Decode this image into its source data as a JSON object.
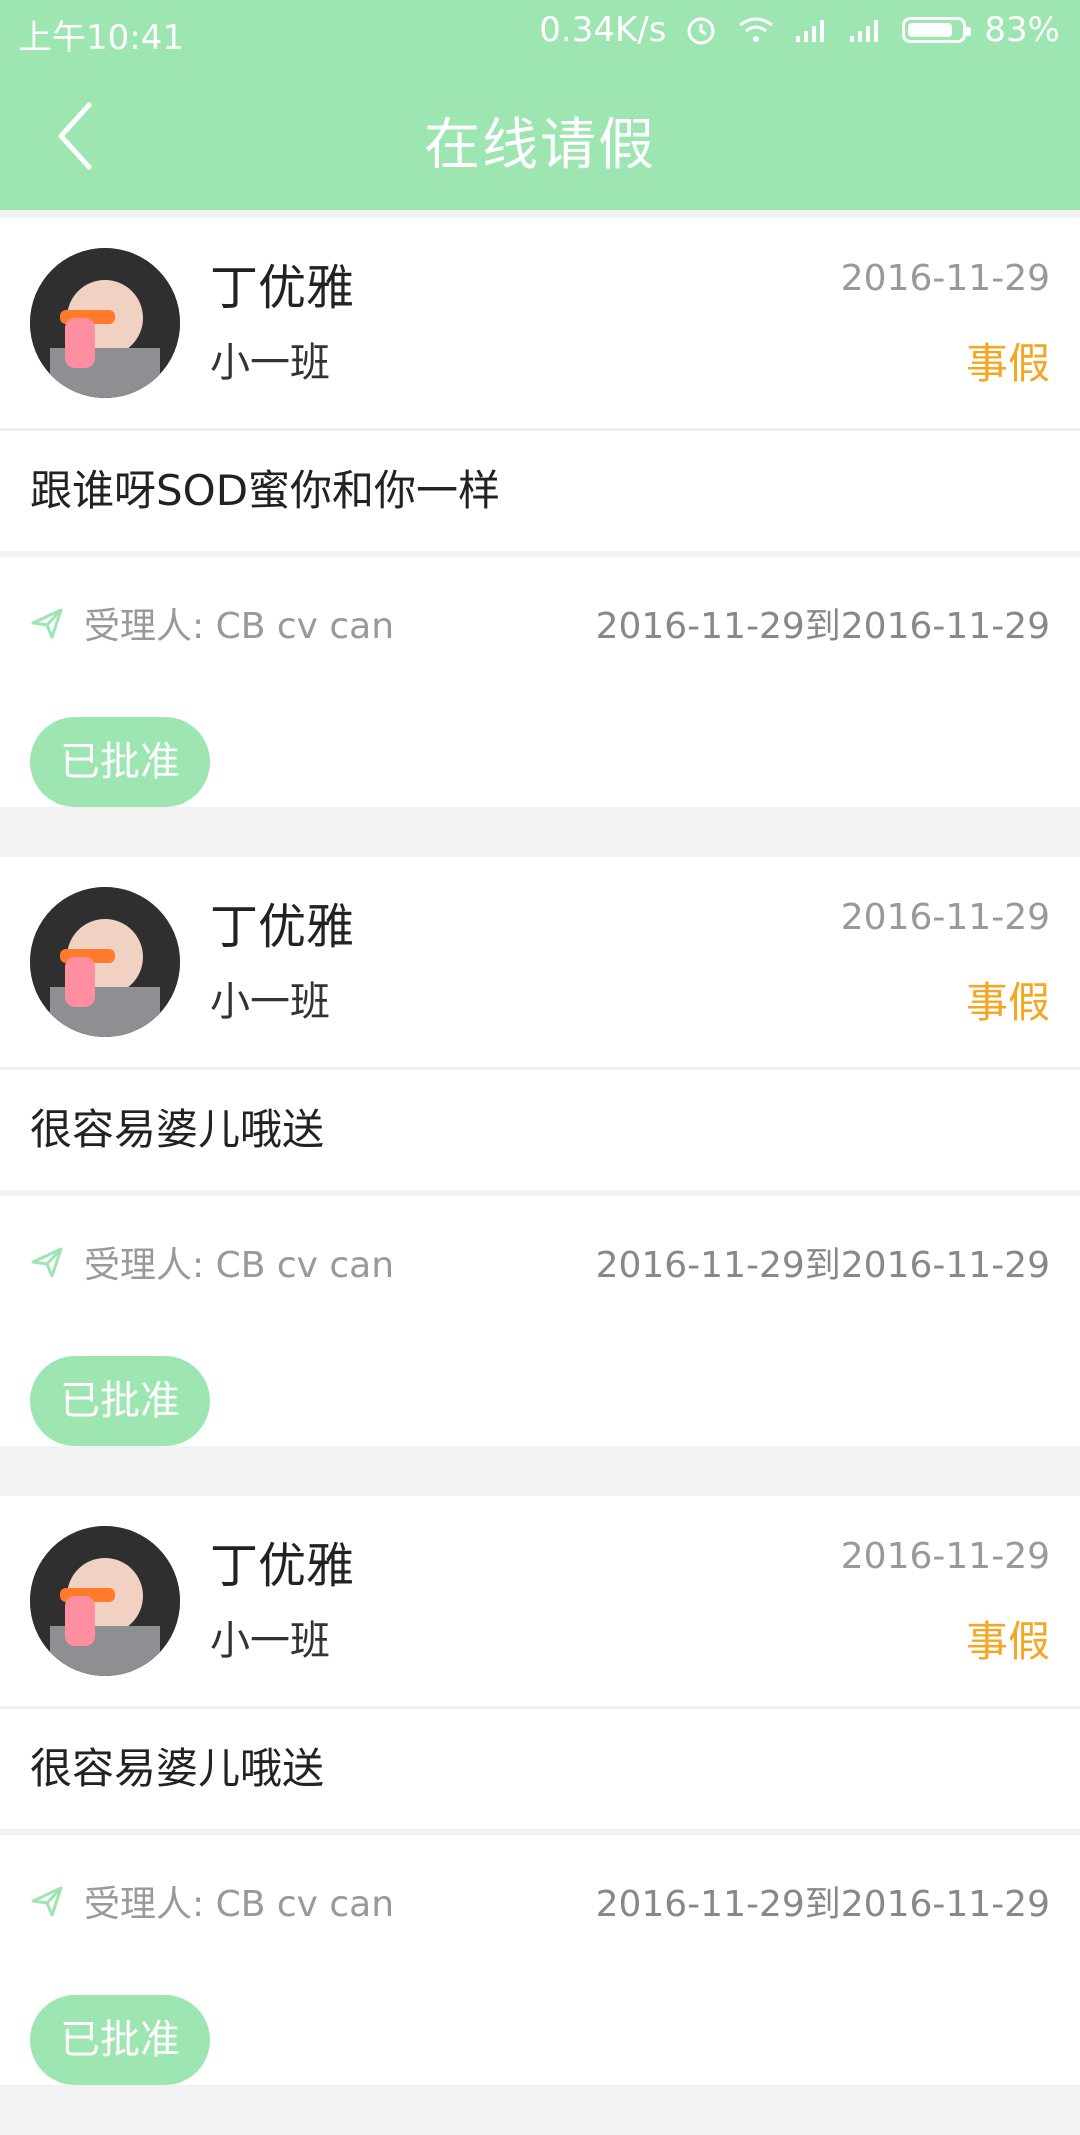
{
  "status_bar": {
    "time": "上午10:41",
    "network_speed": "0.34K/s",
    "battery_percent": "83%",
    "icons": [
      "alarm-icon",
      "wifi-icon",
      "signal-icon",
      "signal-icon",
      "battery-icon"
    ]
  },
  "header": {
    "title": "在线请假",
    "back_icon": "chevron-left-icon"
  },
  "colors": {
    "primary": "#9de5b1",
    "leave_type": "#f5a623",
    "text": "#222222",
    "muted": "#999999"
  },
  "leave_list": [
    {
      "name": "丁优雅",
      "class": "小一班",
      "date": "2016-11-29",
      "type": "事假",
      "reason": "跟谁呀SOD蜜你和你一样",
      "handler": "受理人: CB cv can",
      "range": "2016-11-29到2016-11-29",
      "status": "已批准"
    },
    {
      "name": "丁优雅",
      "class": "小一班",
      "date": "2016-11-29",
      "type": "事假",
      "reason": "很容易婆儿哦送",
      "handler": "受理人: CB cv can",
      "range": "2016-11-29到2016-11-29",
      "status": "已批准"
    },
    {
      "name": "丁优雅",
      "class": "小一班",
      "date": "2016-11-29",
      "type": "事假",
      "reason": "很容易婆儿哦送",
      "handler": "受理人: CB cv can",
      "range": "2016-11-29到2016-11-29",
      "status": "已批准"
    }
  ]
}
